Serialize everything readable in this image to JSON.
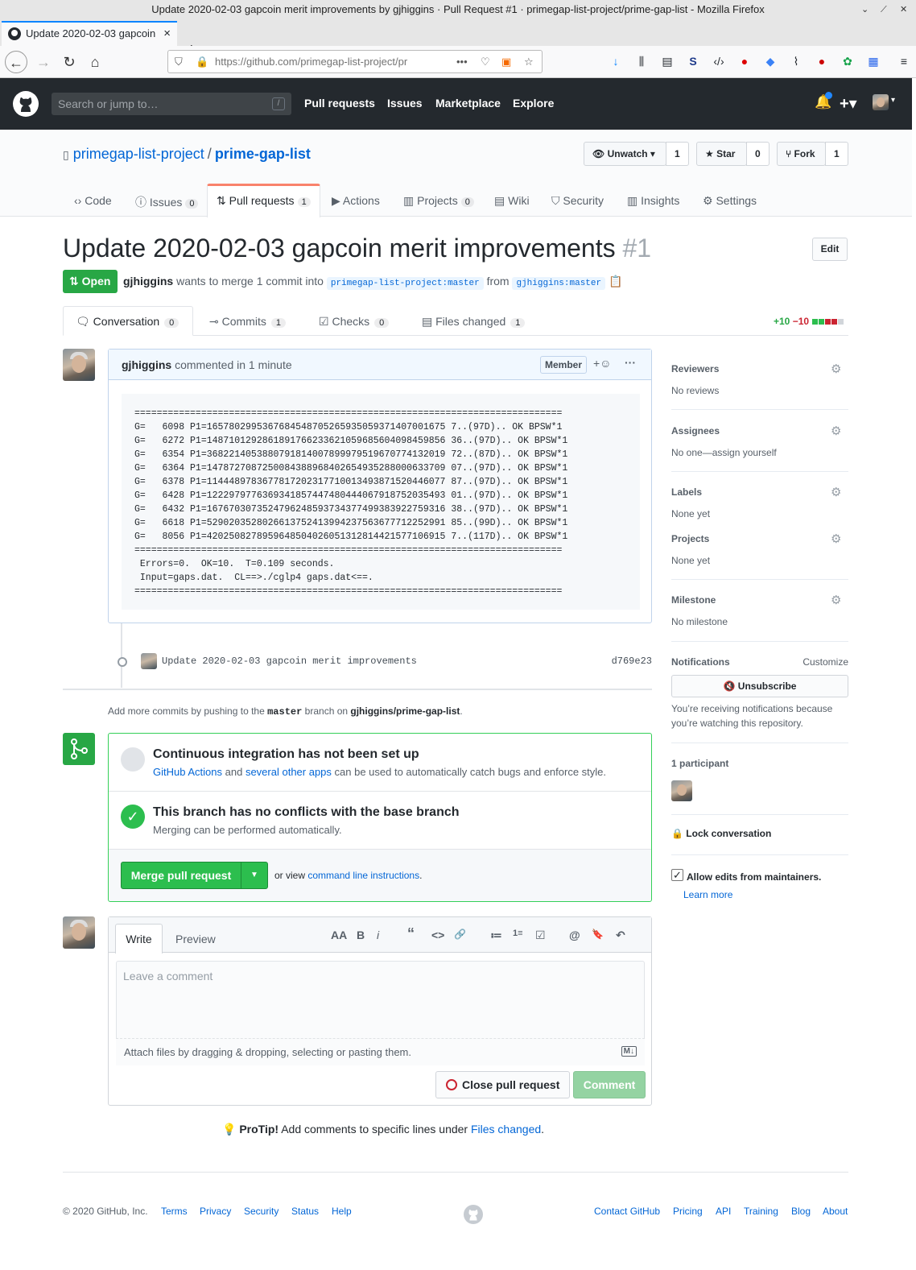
{
  "window": {
    "title": "Update 2020-02-03 gapcoin merit improvements by gjhiggins · Pull Request #1 · primegap-list-project/prime-gap-list - Mozilla Firefox",
    "tab_label": "Update 2020-02-03 gapcoin",
    "url": "https://github.com/primegap-list-project/pr"
  },
  "gh": {
    "search_placeholder": "Search or jump to…",
    "search_key": "/",
    "nav": [
      "Pull requests",
      "Issues",
      "Marketplace",
      "Explore"
    ]
  },
  "repo": {
    "owner": "primegap-list-project",
    "name": "prime-gap-list",
    "watch_label": "Unwatch",
    "watch_count": "1",
    "star_label": "Star",
    "star_count": "0",
    "fork_label": "Fork",
    "fork_count": "1",
    "tabs": [
      {
        "label": "Code"
      },
      {
        "label": "Issues",
        "count": "0"
      },
      {
        "label": "Pull requests",
        "count": "1"
      },
      {
        "label": "Actions"
      },
      {
        "label": "Projects",
        "count": "0"
      },
      {
        "label": "Wiki"
      },
      {
        "label": "Security"
      },
      {
        "label": "Insights"
      },
      {
        "label": "Settings"
      }
    ]
  },
  "pr": {
    "title": "Update 2020-02-03 gapcoin merit improvements",
    "number": "#1",
    "edit_label": "Edit",
    "state": "Open",
    "author": "gjhiggins",
    "meta_text": "wants to merge 1 commit into",
    "base_branch": "primegap-list-project:master",
    "from_text": "from",
    "head_branch": "gjhiggins:master",
    "tabs": [
      {
        "label": "Conversation",
        "count": "0"
      },
      {
        "label": "Commits",
        "count": "1"
      },
      {
        "label": "Checks",
        "count": "0"
      },
      {
        "label": "Files changed",
        "count": "1"
      }
    ],
    "additions": "+10",
    "deletions": "−10"
  },
  "comment": {
    "author": "gjhiggins",
    "time_text": "commented in 1 minute",
    "badge": "Member",
    "body": "=============================================================================\nG=   6098 P1=1657802995367684548705265935059371407001675 7..(97D).. OK BPSW*1\nG=   6272 P1=1487101292861891766233621059685604098459856 36..(97D).. OK BPSW*1\nG=   6354 P1=3682214053880791814007899979519670774132019 72..(87D).. OK BPSW*1\nG=   6364 P1=1478727087250084388968402654935288000633709 07..(97D).. OK BPSW*1\nG=   6378 P1=1144489783677817202317710013493871520446077 87..(97D).. OK BPSW*1\nG=   6428 P1=1222979776369341857447480444067918752035493 01..(97D).. OK BPSW*1\nG=   6432 P1=1676703073524796248593734377499383922759316 38..(97D).. OK BPSW*1\nG=   6618 P1=5290203528026613752413994237563677712252991 85..(99D).. OK BPSW*1\nG=   8056 P1=4202508278959648504026051312814421577106915 7..(117D).. OK BPSW*1\n=============================================================================\n Errors=0.  OK=10.  T=0.109 seconds.\n Input=gaps.dat.  CL==>./cglp4 gaps.dat<==.\n============================================================================="
  },
  "commit": {
    "message": "Update 2020-02-03 gapcoin merit improvements",
    "sha": "d769e23"
  },
  "addmore": {
    "prefix": "Add more commits by pushing to the",
    "branch": "master",
    "middle": "branch on",
    "repo": "gjhiggins/prime-gap-list",
    "suffix": "."
  },
  "merge": {
    "ci_title": "Continuous integration has not been set up",
    "ci_link1": "GitHub Actions",
    "ci_and": "and",
    "ci_link2": "several other apps",
    "ci_rest": "can be used to automatically catch bugs and enforce style.",
    "conflict_title": "This branch has no conflicts with the base branch",
    "conflict_sub": "Merging can be performed automatically.",
    "merge_button": "Merge pull request",
    "or_view": "or view",
    "cli_link": "command line instructions",
    "cli_suffix": "."
  },
  "newcomment": {
    "write_tab": "Write",
    "preview_tab": "Preview",
    "placeholder": "Leave a comment",
    "attach_text": "Attach files by dragging & dropping, selecting or pasting them.",
    "close_button": "Close pull request",
    "comment_button": "Comment",
    "toolbar": [
      "AA",
      "B",
      "i",
      "“",
      "<>",
      "🔗",
      "≔",
      "1≡",
      "☑",
      "@",
      "🔖",
      "↶"
    ]
  },
  "protip": {
    "label": "ProTip!",
    "text": "Add comments to specific lines under",
    "link": "Files changed",
    "suffix": "."
  },
  "sidebar": {
    "reviewers_label": "Reviewers",
    "reviewers_value": "No reviews",
    "assignees_label": "Assignees",
    "assignees_value": "No one—assign yourself",
    "labels_label": "Labels",
    "labels_value": "None yet",
    "projects_label": "Projects",
    "projects_value": "None yet",
    "milestone_label": "Milestone",
    "milestone_value": "No milestone",
    "notifications_label": "Notifications",
    "customize": "Customize",
    "unsubscribe": "Unsubscribe",
    "notif_reason": "You’re receiving notifications because you’re watching this repository.",
    "participants": "1 participant",
    "lock": "Lock conversation",
    "allow_edits": "Allow edits from maintainers.",
    "learn_more": "Learn more"
  },
  "footer": {
    "copyright": "© 2020 GitHub, Inc.",
    "left_links": [
      "Terms",
      "Privacy",
      "Security",
      "Status",
      "Help"
    ],
    "right_links": [
      "Contact GitHub",
      "Pricing",
      "API",
      "Training",
      "Blog",
      "About"
    ]
  },
  "colors": {
    "accent": "#0366d6",
    "success": "#28a745",
    "danger": "#cb2431",
    "header": "#24292e"
  }
}
